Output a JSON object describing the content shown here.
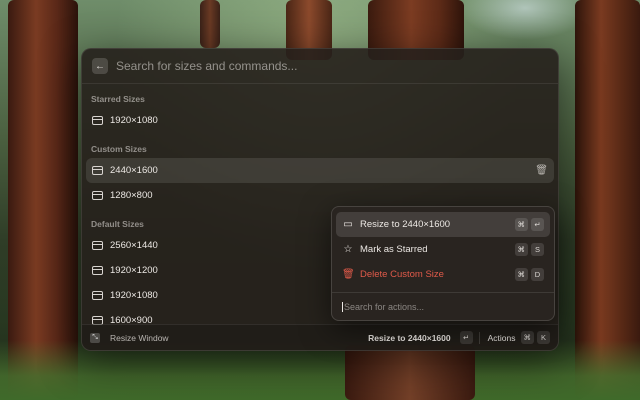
{
  "search": {
    "placeholder": "Search for sizes and commands..."
  },
  "sections": {
    "starred": {
      "title": "Starred Sizes",
      "items": [
        "1920×1080"
      ]
    },
    "custom": {
      "title": "Custom Sizes",
      "items": [
        "2440×1600",
        "1280×800"
      ]
    },
    "default": {
      "title": "Default Sizes",
      "items": [
        "2560×1440",
        "1920×1200",
        "1920×1080",
        "1600×900"
      ]
    }
  },
  "footer": {
    "app_label": "Resize Window",
    "primary_action": "Resize to 2440×1600",
    "enter_key": "↵",
    "actions_label": "Actions",
    "cmd_key": "⌘",
    "k_key": "K"
  },
  "actions_menu": {
    "items": [
      {
        "label": "Resize to 2440×1600",
        "keys": [
          "⌘",
          "↵"
        ]
      },
      {
        "label": "Mark as Starred",
        "keys": [
          "⌘",
          "S"
        ]
      },
      {
        "label": "Delete Custom Size",
        "keys": [
          "⌘",
          "D"
        ]
      }
    ],
    "search_placeholder": "Search for actions..."
  },
  "colors": {
    "danger": "#e05a4a",
    "panel": "#26201c"
  }
}
